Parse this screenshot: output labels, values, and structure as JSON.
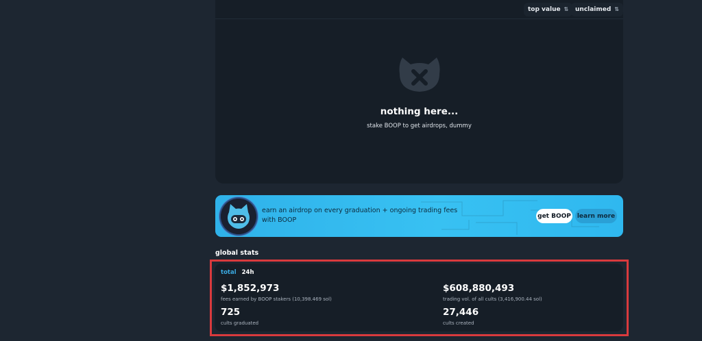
{
  "airdrops": {
    "sort_options": {
      "value_sort": "top value",
      "status_filter": "unclaimed"
    },
    "empty_state": {
      "title": "nothing here...",
      "subtitle": "stake BOOP to get airdrops, dummy",
      "icon": "cat-x-icon"
    }
  },
  "promo": {
    "text": "earn an airdrop on every graduation + ongoing trading fees with BOOP",
    "get_button": "get BOOP",
    "learn_button": "learn more",
    "icon": "boop-cat-avatar",
    "accent": "#38c1f2"
  },
  "global_stats": {
    "title": "global stats",
    "tabs": [
      "total",
      "24h"
    ],
    "active_tab": "total",
    "stats": [
      {
        "value": "$1,852,973",
        "label": "fees earned by BOOP stakers (10,398.469 sol)"
      },
      {
        "value": "$608,880,493",
        "label": "trading vol. of all cults (3,416,900.44 sol)"
      },
      {
        "value": "725",
        "label": "cults graduated"
      },
      {
        "value": "27,446",
        "label": "cults created"
      }
    ]
  },
  "colors": {
    "background": "#1d2631",
    "panel": "#161e27",
    "tab_active": "#3aa9e0",
    "highlight_border": "#d93a3d"
  }
}
